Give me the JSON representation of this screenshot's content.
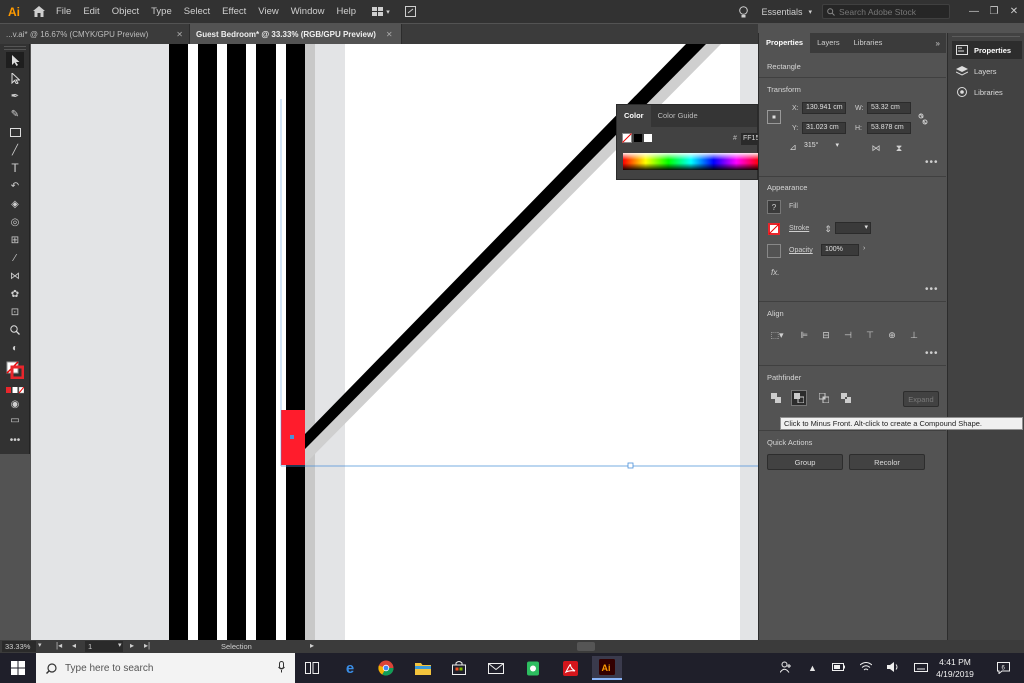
{
  "app": {
    "logo": "Ai",
    "brand_color": "#ff9a00"
  },
  "menu": {
    "items": [
      "File",
      "Edit",
      "Object",
      "Type",
      "Select",
      "Effect",
      "View",
      "Window",
      "Help"
    ]
  },
  "workspace": {
    "label": "Essentials",
    "search_placeholder": "Search Adobe Stock"
  },
  "tabs": [
    {
      "label": "...v.ai* @ 16.67% (CMYK/GPU Preview)",
      "active": false
    },
    {
      "label": "Guest Bedroom* @ 33.33% (RGB/GPU Preview)",
      "active": true
    }
  ],
  "color_panel": {
    "tabs": [
      "Color",
      "Color Guide"
    ],
    "hex_label": "#",
    "hex_value": "FF15"
  },
  "properties": {
    "tabs": [
      "Properties",
      "Layers",
      "Libraries"
    ],
    "object_type": "Rectangle",
    "transform": {
      "heading": "Transform",
      "x_label": "X:",
      "x": "130.941 cm",
      "y_label": "Y:",
      "y": "31.023 cm",
      "w_label": "W:",
      "w": "53.32 cm",
      "h_label": "H:",
      "h": "53.878 cm",
      "rotation": "315°"
    },
    "appearance": {
      "heading": "Appearance",
      "fill_label": "Fill",
      "stroke_label": "Stroke",
      "opacity_label": "Opacity",
      "opacity": "100%",
      "fx_label": "fx."
    },
    "align": {
      "heading": "Align"
    },
    "pathfinder": {
      "heading": "Pathfinder",
      "expand_label": "Expand"
    },
    "quick_actions": {
      "heading": "Quick Actions",
      "group_label": "Group",
      "recolor_label": "Recolor"
    }
  },
  "tooltip": "Click to Minus Front. Alt-click to create a Compound Shape.",
  "dock": {
    "items": [
      "Properties",
      "Layers",
      "Libraries"
    ]
  },
  "status": {
    "zoom": "33.33%",
    "artboard": "1",
    "tool": "Selection"
  },
  "taskbar": {
    "search_placeholder": "Type here to search",
    "time": "4:41 PM",
    "date": "4/19/2019"
  },
  "colors": {
    "selection_red": "#ff1c2c",
    "selection_blue": "#4a90d9"
  }
}
